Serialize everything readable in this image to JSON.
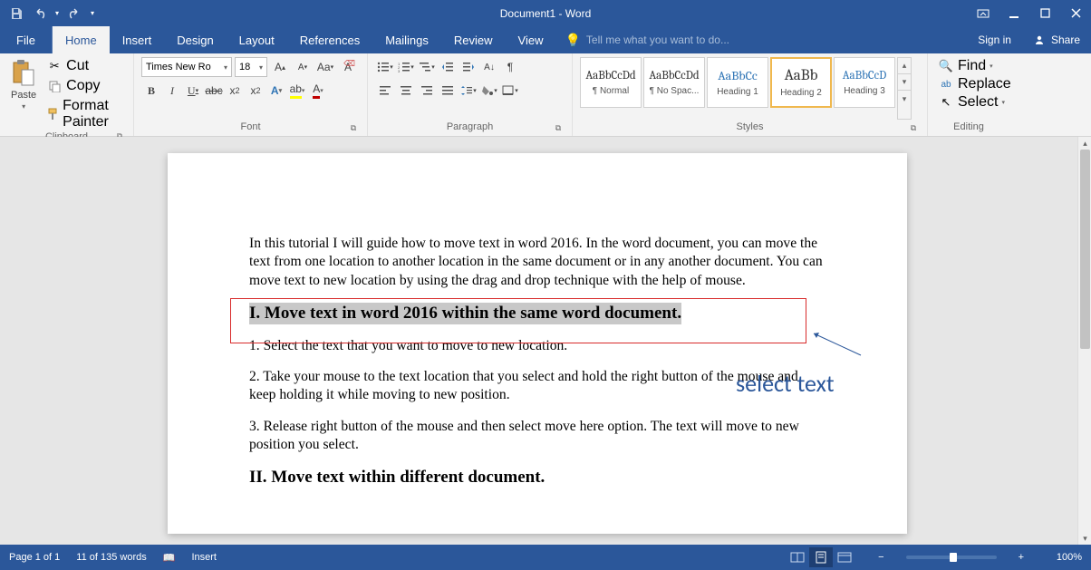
{
  "title": "Document1 - Word",
  "qat": {
    "save": "💾",
    "undo": "↶",
    "redo": "↻"
  },
  "tabs": {
    "file": "File",
    "home": "Home",
    "insert": "Insert",
    "design": "Design",
    "layout": "Layout",
    "references": "References",
    "mailings": "Mailings",
    "review": "Review",
    "view": "View"
  },
  "tellme": "Tell me what you want to do...",
  "signin": "Sign in",
  "share": "Share",
  "clipboard": {
    "paste": "Paste",
    "cut": "Cut",
    "copy": "Copy",
    "format_painter": "Format Painter",
    "label": "Clipboard"
  },
  "font": {
    "name": "Times New Ro",
    "size": "18",
    "label": "Font"
  },
  "paragraph": {
    "label": "Paragraph"
  },
  "styles": {
    "label": "Styles",
    "items": [
      {
        "preview": "AaBbCcDd",
        "name": "¶ Normal"
      },
      {
        "preview": "AaBbCcDd",
        "name": "¶ No Spac..."
      },
      {
        "preview": "AaBbCc",
        "name": "Heading 1"
      },
      {
        "preview": "AaBb",
        "name": "Heading 2"
      },
      {
        "preview": "AaBbCcD",
        "name": "Heading 3"
      }
    ]
  },
  "editing": {
    "find": "Find",
    "replace": "Replace",
    "select": "Select",
    "label": "Editing"
  },
  "doc": {
    "p1": "In this tutorial I will guide how to move text in word 2016. In the word document, you can move the text from one location to another location in the same document or in any another document. You can move text to new location by using the drag and drop technique with the help of mouse.",
    "h1": "I. Move text in word 2016 within the same word document.",
    "s1": "1. Select the text that you want to move to new location.",
    "s2": "2. Take your mouse to the text location that you select and hold the right button of the mouse and keep holding it while moving to new position.",
    "s3": "3. Release right button of the mouse and then select move here option. The text will move to new position you select.",
    "h2": "II. Move text within different document."
  },
  "annotation": "select text",
  "status": {
    "page": "Page 1 of 1",
    "words": "11 of 135 words",
    "mode": "Insert",
    "zoom": "100%"
  }
}
